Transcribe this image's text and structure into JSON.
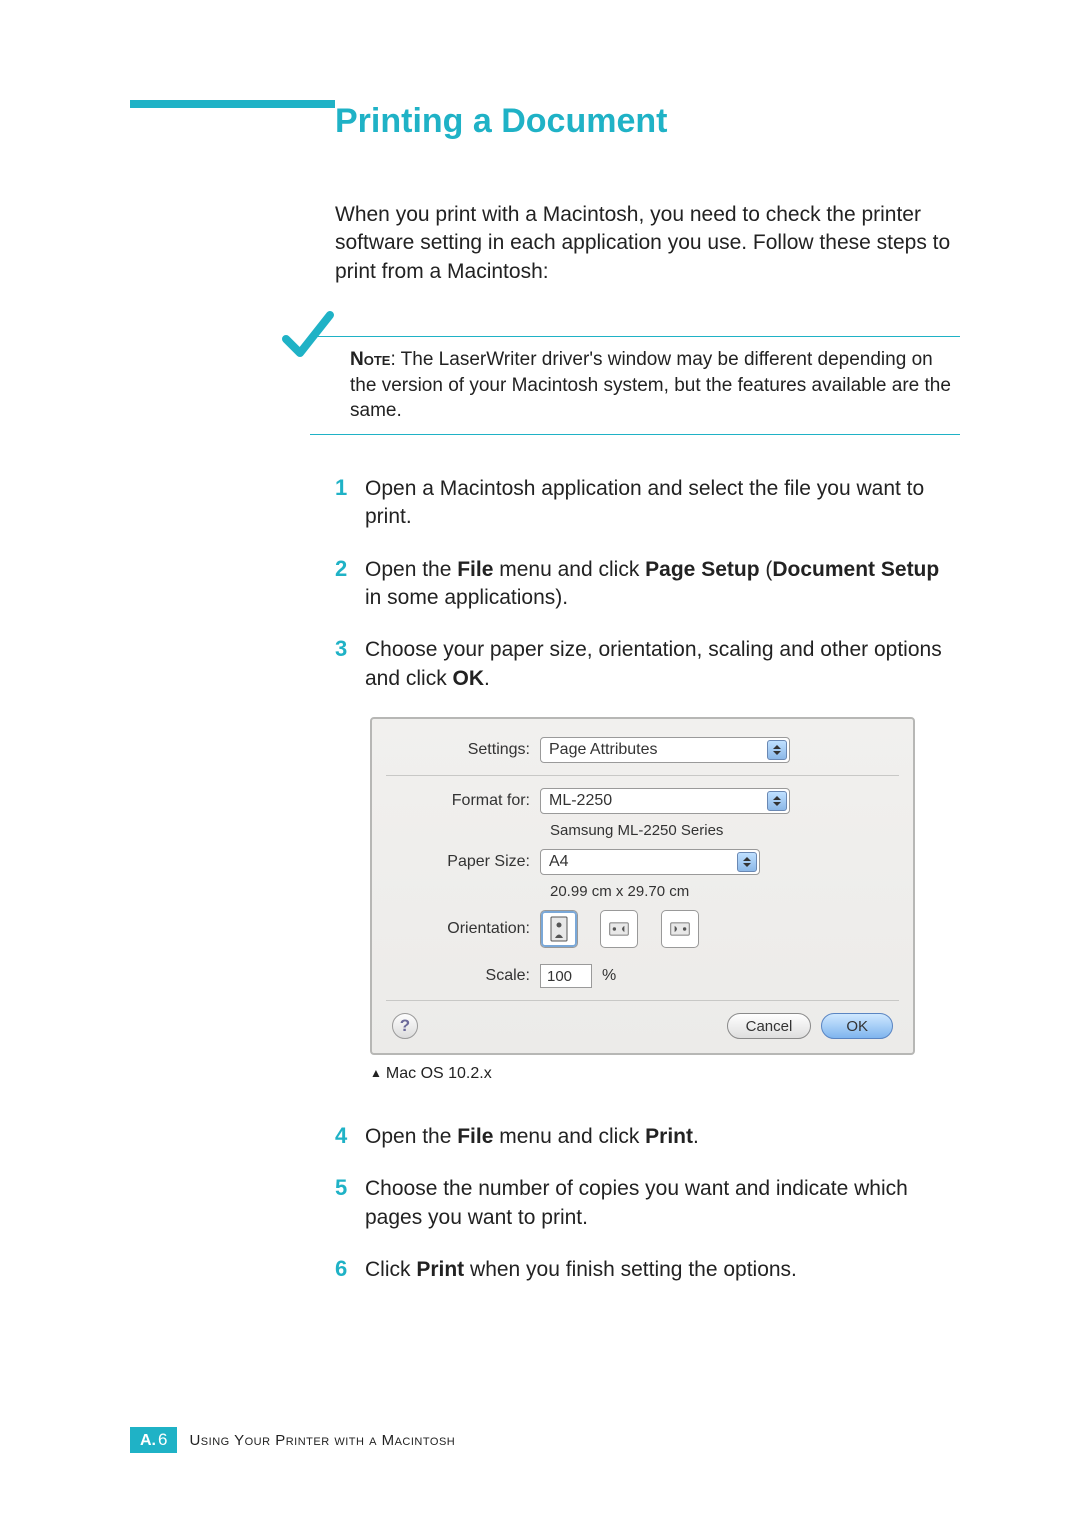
{
  "heading": "Printing a Document",
  "intro": "When you print with a Macintosh, you need to check the printer software setting in each application you use. Follow these steps to print from a Macintosh:",
  "note": {
    "label": "Note",
    "text": ": The LaserWriter driver's window may be different depending on the version of your Macintosh system, but the features available are the same."
  },
  "steps": {
    "s1": {
      "n": "1",
      "text": "Open a Macintosh application and select the file you want to print."
    },
    "s2": {
      "n": "2",
      "pre": "Open the ",
      "b1": "File",
      "mid1": " menu and click ",
      "b2": "Page Setup",
      "mid2": " (",
      "b3": "Document Setup",
      "post": " in some applications)."
    },
    "s3": {
      "n": "3",
      "pre": "Choose your paper size, orientation, scaling and other options and click ",
      "b1": "OK",
      "post": "."
    },
    "s4": {
      "n": "4",
      "pre": "Open the ",
      "b1": "File",
      "mid": " menu and click ",
      "b2": "Print",
      "post": "."
    },
    "s5": {
      "n": "5",
      "text": "Choose the number of copies you want and indicate which pages you want to print."
    },
    "s6": {
      "n": "6",
      "pre": "Click ",
      "b1": "Print",
      "post": " when you finish setting the options."
    }
  },
  "dialog": {
    "labels": {
      "settings": "Settings:",
      "format_for": "Format for:",
      "paper_size": "Paper Size:",
      "orientation": "Orientation:",
      "scale": "Scale:"
    },
    "values": {
      "settings": "Page Attributes",
      "format_for": "ML-2250",
      "format_for_sub": "Samsung ML-2250 Series",
      "paper_size": "A4",
      "paper_size_sub": "20.99 cm x 29.70 cm",
      "scale": "100",
      "scale_unit": "%"
    },
    "buttons": {
      "help": "?",
      "cancel": "Cancel",
      "ok": "OK"
    }
  },
  "caption": "Mac OS 10.2.x",
  "footer": {
    "badge_prefix": "A.",
    "badge_num": "6",
    "text": "Using Your Printer with a Macintosh"
  }
}
